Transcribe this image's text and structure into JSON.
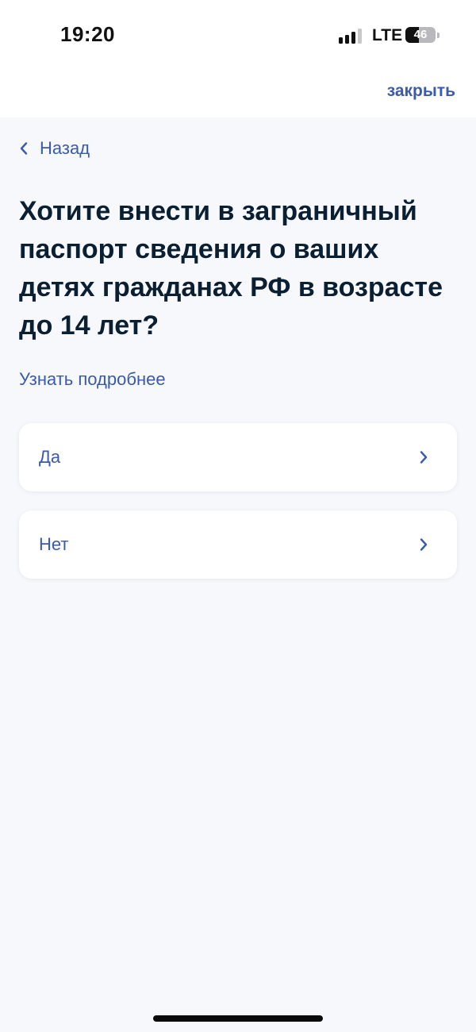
{
  "status_bar": {
    "time": "19:20",
    "network": "LTE",
    "battery_level": "46",
    "battery_fraction": 0.46,
    "signal_bars_active": 3,
    "signal_bars_total": 4
  },
  "header": {
    "close_label": "закрыть"
  },
  "nav": {
    "back_label": "Назад",
    "back_icon": "chevron-left-icon"
  },
  "question": {
    "title": "Хотите внести в заграничный паспорт сведения о ваших детях гражданах РФ в возрасте до 14 лет?",
    "more_link": "Узнать подробнее"
  },
  "options": [
    {
      "label": "Да",
      "icon": "chevron-right-icon"
    },
    {
      "label": "Нет",
      "icon": "chevron-right-icon"
    }
  ],
  "colors": {
    "accent": "#3a5bab",
    "title": "#0b1f33",
    "background": "#f6f8fc",
    "card": "#ffffff"
  }
}
